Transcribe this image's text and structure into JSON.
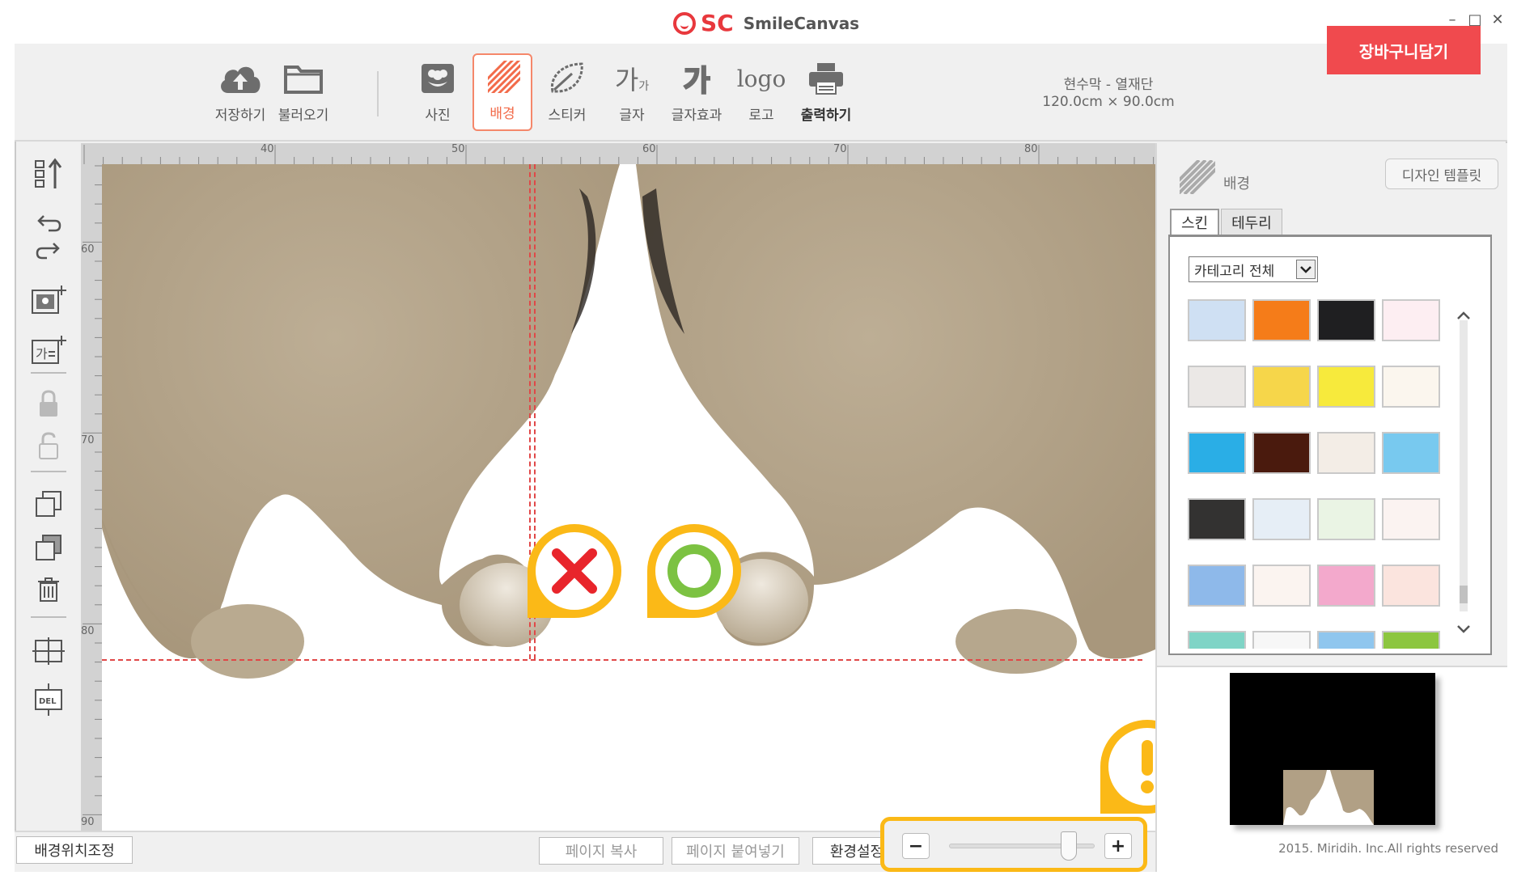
{
  "app": {
    "brand_short": "SC",
    "brand_name": "SmileCanvas",
    "window_controls": {
      "minimize": "–",
      "maximize": "□",
      "close": "✕"
    }
  },
  "toolbar": {
    "save_label": "저장하기",
    "load_label": "불러오기",
    "photo_label": "사진",
    "background_label": "배경",
    "sticker_label": "스티커",
    "text_label": "글자",
    "text_effect_label": "글자효과",
    "logo_label": "로고",
    "print_label": "출력하기",
    "text_icon_glyph": "가",
    "text_icon_sub": "가",
    "effect_icon_glyph": "가",
    "logo_icon_text": "logo"
  },
  "product": {
    "name": "현수막 - 열재단",
    "size": "120.0cm × 90.0cm"
  },
  "cart_button": "장바구니담기",
  "ruler": {
    "h_labels": [
      "40",
      "50",
      "60",
      "70",
      "80"
    ],
    "v_labels": [
      "60",
      "70",
      "80",
      "90"
    ]
  },
  "right_panel": {
    "title": "배경",
    "design_template_button": "디자인 템플릿",
    "tabs": [
      "스킨",
      "테두리"
    ],
    "active_tab": "스킨",
    "category_select": "카테고리 전체",
    "swatch_colors": [
      [
        "#cfe0f3",
        "#f57c19",
        "#1f1f21",
        "#fdeef2"
      ],
      [
        "#ebe8e6",
        "#f6d64a",
        "#f7ea3c",
        "#fbf6ee"
      ],
      [
        "#2aaee6",
        "#4a1a0d",
        "#f3ede6",
        "#78c9ef"
      ],
      [
        "#333231",
        "#e6eef6",
        "#eaf4e4",
        "#fbf3f1"
      ],
      [
        "#8eb9ea",
        "#fbf4f0",
        "#f3a9cc",
        "#fbe4de"
      ],
      [
        "#7fd4c6",
        "#f7f7f7",
        "#8fc6ee",
        "#8cc63f"
      ]
    ]
  },
  "bottom_bar": {
    "bg_position_button": "배경위치조정",
    "page_copy_button": "페이지 복사",
    "page_paste_button": "페이지 붙여넣기",
    "settings_button": "환경설정",
    "zoom_minus": "−",
    "zoom_plus": "+",
    "zoom_level": 0.82
  },
  "footer": {
    "copyright": "2015. Miridih. Inc.All rights reserved"
  },
  "colors": {
    "brand_red": "#e8383d",
    "cart_red": "#f04a4e",
    "active_tool": "#f26b4a",
    "marker_yellow": "#fbb917",
    "cut_line": "#e04848",
    "cat_fur": "#b8a78d"
  },
  "icons": {
    "save": "cloud-upload-icon",
    "load": "folder-icon",
    "photo": "flower-photo-icon",
    "background": "striped-pattern-icon",
    "sticker": "sticker-leaf-icon",
    "text": "text-ga-icon",
    "text_effect": "text-effect-icon",
    "logo": "logo-text-icon",
    "print": "printer-icon",
    "markers": [
      "x-mark-icon",
      "circle-ok-icon",
      "exclamation-icon"
    ]
  }
}
